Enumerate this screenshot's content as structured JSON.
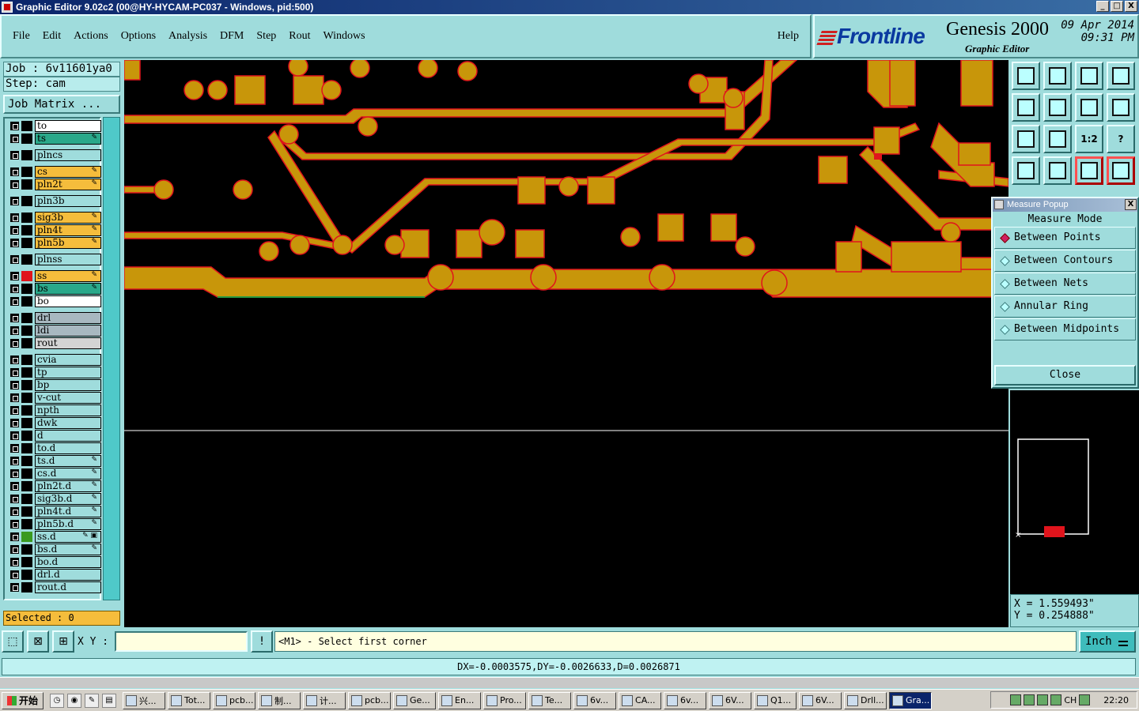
{
  "window": {
    "title": "Graphic Editor 9.02c2 (00@HY-HYCAM-PC037 - Windows, pid:500)",
    "buttons": [
      "_",
      "□",
      "X"
    ]
  },
  "menu": {
    "items": [
      "File",
      "Edit",
      "Actions",
      "Options",
      "Analysis",
      "DFM",
      "Step",
      "Rout",
      "Windows"
    ],
    "help": "Help"
  },
  "brand": {
    "logo": "Frontline",
    "product": "Genesis 2000",
    "subtitle": "Graphic Editor",
    "date": "09 Apr 2014",
    "time": "09:31 PM"
  },
  "job": {
    "job_label": "Job : 6v11601ya0",
    "step_label": "Step: cam",
    "matrix_button": "Job Matrix ...",
    "selected": "Selected : 0"
  },
  "layers": [
    {
      "name": "to",
      "color": "#ffffff",
      "mark": ""
    },
    {
      "name": "ts",
      "color": "#2aa88a",
      "mark": "✎"
    },
    {
      "name": "plncs",
      "color": "#9fdcdc",
      "mark": ""
    },
    {
      "name": "cs",
      "color": "#f5bd3c",
      "mark": "✎"
    },
    {
      "name": "pln2t",
      "color": "#f5bd3c",
      "mark": "✎"
    },
    {
      "name": "pln3b",
      "color": "#9fdcdc",
      "mark": ""
    },
    {
      "name": "sig3b",
      "color": "#f5bd3c",
      "mark": "✎"
    },
    {
      "name": "pln4t",
      "color": "#f5bd3c",
      "mark": "✎"
    },
    {
      "name": "pln5b",
      "color": "#f5bd3c",
      "mark": "✎"
    },
    {
      "name": "plnss",
      "color": "#9fdcdc",
      "mark": ""
    },
    {
      "name": "ss",
      "color": "#f5bd3c",
      "mark": "✎",
      "active": true
    },
    {
      "name": "bs",
      "color": "#2aa88a",
      "mark": "✎"
    },
    {
      "name": "bo",
      "color": "#ffffff",
      "mark": ""
    },
    {
      "name": "drl",
      "color": "#a8b8c0",
      "mark": ""
    },
    {
      "name": "ldi",
      "color": "#a8b8c0",
      "mark": ""
    },
    {
      "name": "rout",
      "color": "#d4d4d4",
      "mark": ""
    },
    {
      "name": "cvia",
      "color": "#9fdcdc",
      "mark": ""
    },
    {
      "name": "tp",
      "color": "#9fdcdc",
      "mark": ""
    },
    {
      "name": "bp",
      "color": "#9fdcdc",
      "mark": ""
    },
    {
      "name": "v-cut",
      "color": "#9fdcdc",
      "mark": ""
    },
    {
      "name": "npth",
      "color": "#9fdcdc",
      "mark": ""
    },
    {
      "name": "dwk",
      "color": "#9fdcdc",
      "mark": ""
    },
    {
      "name": "d",
      "color": "#9fdcdc",
      "mark": ""
    },
    {
      "name": "to.d",
      "color": "#9fdcdc",
      "mark": ""
    },
    {
      "name": "ts.d",
      "color": "#9fdcdc",
      "mark": "✎"
    },
    {
      "name": "cs.d",
      "color": "#9fdcdc",
      "mark": "✎"
    },
    {
      "name": "pln2t.d",
      "color": "#9fdcdc",
      "mark": "✎"
    },
    {
      "name": "sig3b.d",
      "color": "#9fdcdc",
      "mark": "✎"
    },
    {
      "name": "pln4t.d",
      "color": "#9fdcdc",
      "mark": "✎"
    },
    {
      "name": "pln5b.d",
      "color": "#9fdcdc",
      "mark": "✎"
    },
    {
      "name": "ss.d",
      "color": "#9fdcdc",
      "mark": "✎ ▣",
      "swatch": "#3a9a20"
    },
    {
      "name": "bs.d",
      "color": "#9fdcdc",
      "mark": "✎"
    },
    {
      "name": "bo.d",
      "color": "#9fdcdc",
      "mark": ""
    },
    {
      "name": "drl.d",
      "color": "#9fdcdc",
      "mark": ""
    },
    {
      "name": "rout.d",
      "color": "#9fdcdc",
      "mark": ""
    }
  ],
  "toolbar_icons": [
    "zoom-home-icon",
    "zoom-in-icon",
    "home-icon",
    "window-icon",
    "pan-left-icon",
    "pan-right-icon",
    "undo-zoom-icon",
    "redraw-icon",
    "fit-icon",
    "zoom-center-icon",
    "one-to-one-icon",
    "help-icon",
    "snap-icon",
    "measure-icon",
    "net-red-icon",
    "net-red2-icon"
  ],
  "toolbar_text": {
    "one_to_one": "1:2",
    "help": "?"
  },
  "measure": {
    "title": "Measure Popup",
    "mode_label": "Measure Mode",
    "options": [
      "Between Points",
      "Between Contours",
      "Between Nets",
      "Annular Ring",
      "Between Midpoints"
    ],
    "selected": 0,
    "close": "Close"
  },
  "coords": {
    "x": "X = 1.559493\"",
    "y": "Y = 0.254888\""
  },
  "command": {
    "xy_label": "X Y :",
    "xy_value": "",
    "prompt_icon": "!",
    "prompt": "<M1> - Select first corner",
    "unit": "Inch"
  },
  "status": "DX=-0.0003575,DY=-0.0026633,D=0.0026871",
  "taskbar": {
    "start": "开始",
    "tasks": [
      "兴...",
      "Tot...",
      "pcb...",
      "制...",
      "计...",
      "pcb...",
      "Ge...",
      "En...",
      "Pro...",
      "Te...",
      "6v...",
      "CA...",
      "6v...",
      "6V...",
      "Q1...",
      "6V...",
      "Drll...",
      "Gra..."
    ],
    "active_index": 17,
    "tray_lang": "CH",
    "clock": "22:20"
  },
  "colors": {
    "copper": "#c8960a",
    "outline": "#e0141c",
    "panel": "#9fdcdc"
  }
}
